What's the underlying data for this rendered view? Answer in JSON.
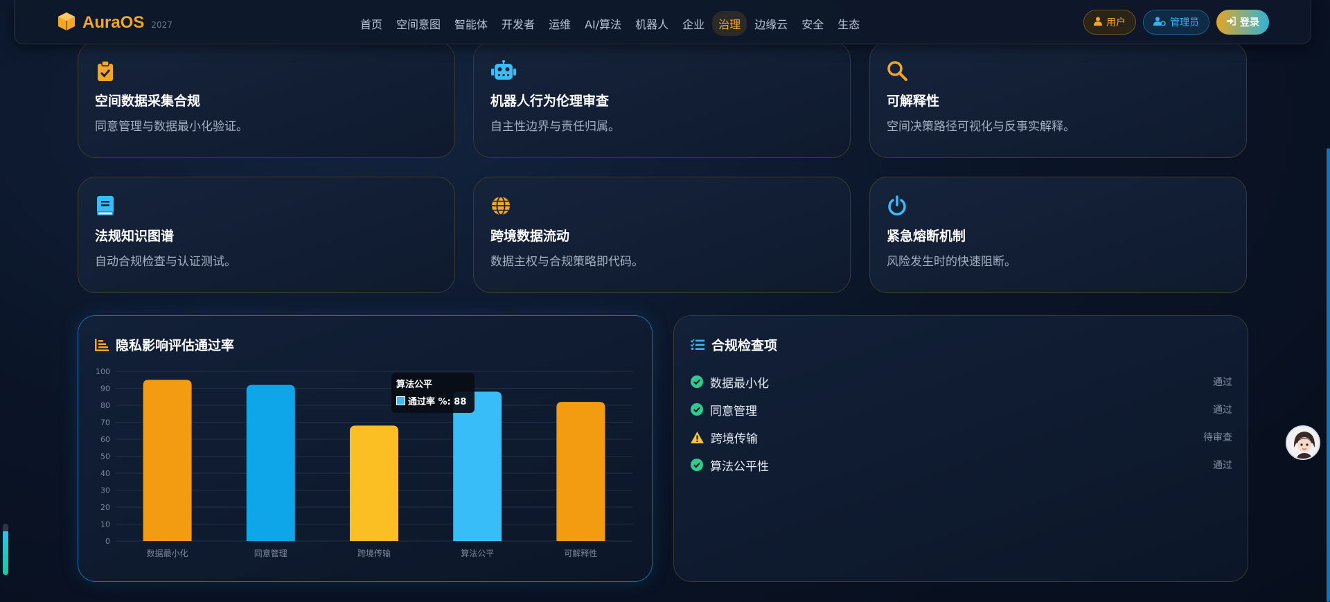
{
  "app": {
    "brand": "AuraOS",
    "year": "2027",
    "nav": [
      "首页",
      "空间意图",
      "智能体",
      "开发者",
      "运维",
      "AI/算法",
      "机器人",
      "企业",
      "治理",
      "边缘云",
      "安全",
      "生态"
    ],
    "active_nav": "治理",
    "actions": {
      "user": "用户",
      "admin": "管理员",
      "login": "登录"
    }
  },
  "cards": [
    {
      "icon": "clipboard-check-icon",
      "icon_color": "#f5a623",
      "title": "空间数据采集合规",
      "desc": "同意管理与数据最小化验证。"
    },
    {
      "icon": "robot-icon",
      "icon_color": "#38bdf8",
      "title": "机器人行为伦理审查",
      "desc": "自主性边界与责任归属。"
    },
    {
      "icon": "search-icon",
      "icon_color": "#f5a623",
      "title": "可解释性",
      "desc": "空间决策路径可视化与反事实解释。"
    },
    {
      "icon": "book-icon",
      "icon_color": "#38bdf8",
      "title": "法规知识图谱",
      "desc": "自动合规检查与认证测试。"
    },
    {
      "icon": "globe-icon",
      "icon_color": "#f5a623",
      "title": "跨境数据流动",
      "desc": "数据主权与合规策略即代码。"
    },
    {
      "icon": "power-icon",
      "icon_color": "#38bdf8",
      "title": "紧急熔断机制",
      "desc": "风险发生时的快速阻断。"
    }
  ],
  "chart_panel": {
    "title": "隐私影响评估通过率"
  },
  "chart_data": {
    "type": "bar",
    "categories": [
      "数据最小化",
      "同意管理",
      "跨境传输",
      "算法公平",
      "可解释性"
    ],
    "values": [
      95,
      92,
      68,
      88,
      82
    ],
    "colors": [
      "#f39c12",
      "#0ea5e9",
      "#fbbf24",
      "#38bdf8",
      "#f39c12"
    ],
    "series_name": "通过率 %",
    "ylim": [
      0,
      100
    ],
    "yticks": [
      0,
      10,
      20,
      30,
      40,
      50,
      60,
      70,
      80,
      90,
      100
    ],
    "grid": true,
    "tooltip": {
      "title": "算法公平",
      "label": "通过率 %: 88"
    }
  },
  "check_panel": {
    "title": "合规检查项",
    "items": [
      {
        "label": "数据最小化",
        "status": "通过",
        "state": "pass"
      },
      {
        "label": "同意管理",
        "status": "通过",
        "state": "pass"
      },
      {
        "label": "跨境传输",
        "status": "待审查",
        "state": "warn"
      },
      {
        "label": "算法公平性",
        "status": "通过",
        "state": "pass"
      }
    ]
  },
  "colors": {
    "accent_orange": "#f5a623",
    "accent_blue": "#38bdf8",
    "pass_green": "#2ecc8f",
    "warn_yellow": "#f5c242"
  },
  "side_gauge_level": 0.85
}
